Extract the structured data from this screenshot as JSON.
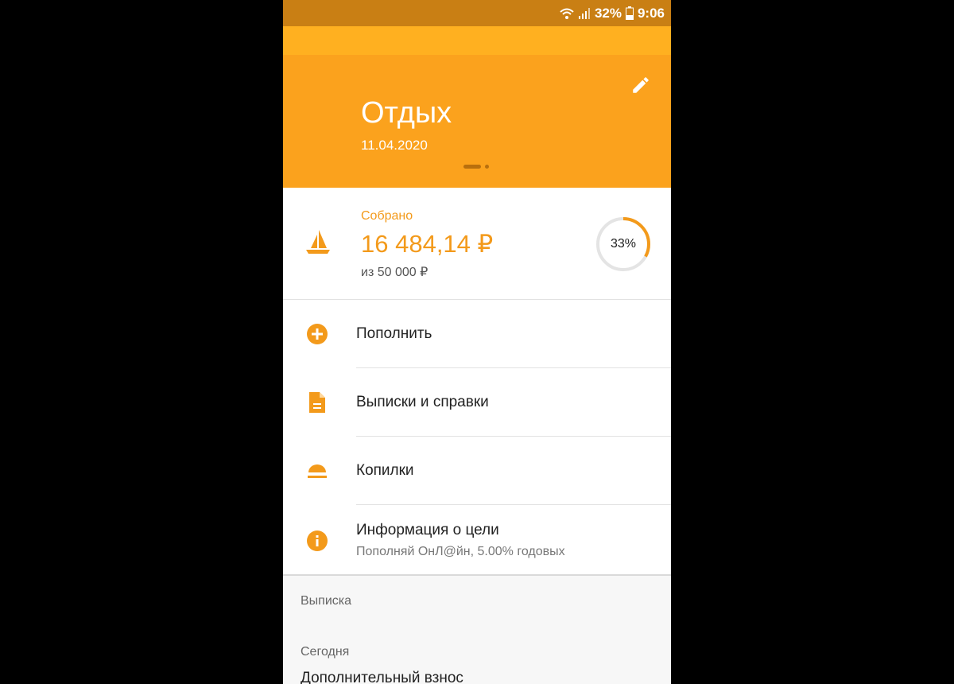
{
  "status_bar": {
    "battery": "32%",
    "time": "9:06",
    "icons": [
      "wifi-icon",
      "signal-icon",
      "battery-icon"
    ]
  },
  "goal": {
    "title": "Отдых",
    "date": "11.04.2020",
    "header_color": "#fba21d"
  },
  "summary": {
    "collected_label": "Собрано",
    "collected_amount": "16 484,14 ₽",
    "target": "из 50 000 ₽",
    "progress_text": "33%",
    "progress_fraction": 0.33,
    "accent_color": "#f39a1b",
    "icon": "sailboat-icon"
  },
  "menu": [
    {
      "label": "Пополнить",
      "icon": "add-circle-icon"
    },
    {
      "label": "Выписки и справки",
      "icon": "document-icon"
    },
    {
      "label": "Копилки",
      "icon": "piggy-bank-icon"
    },
    {
      "label": "Информация о цели",
      "subtitle": "Пополняй ОнЛ@йн, 5.00% годовых",
      "icon": "info-icon"
    }
  ],
  "statement": {
    "section_title": "Выписка",
    "group_label": "Сегодня",
    "first_item": "Дополнительный взнос"
  }
}
